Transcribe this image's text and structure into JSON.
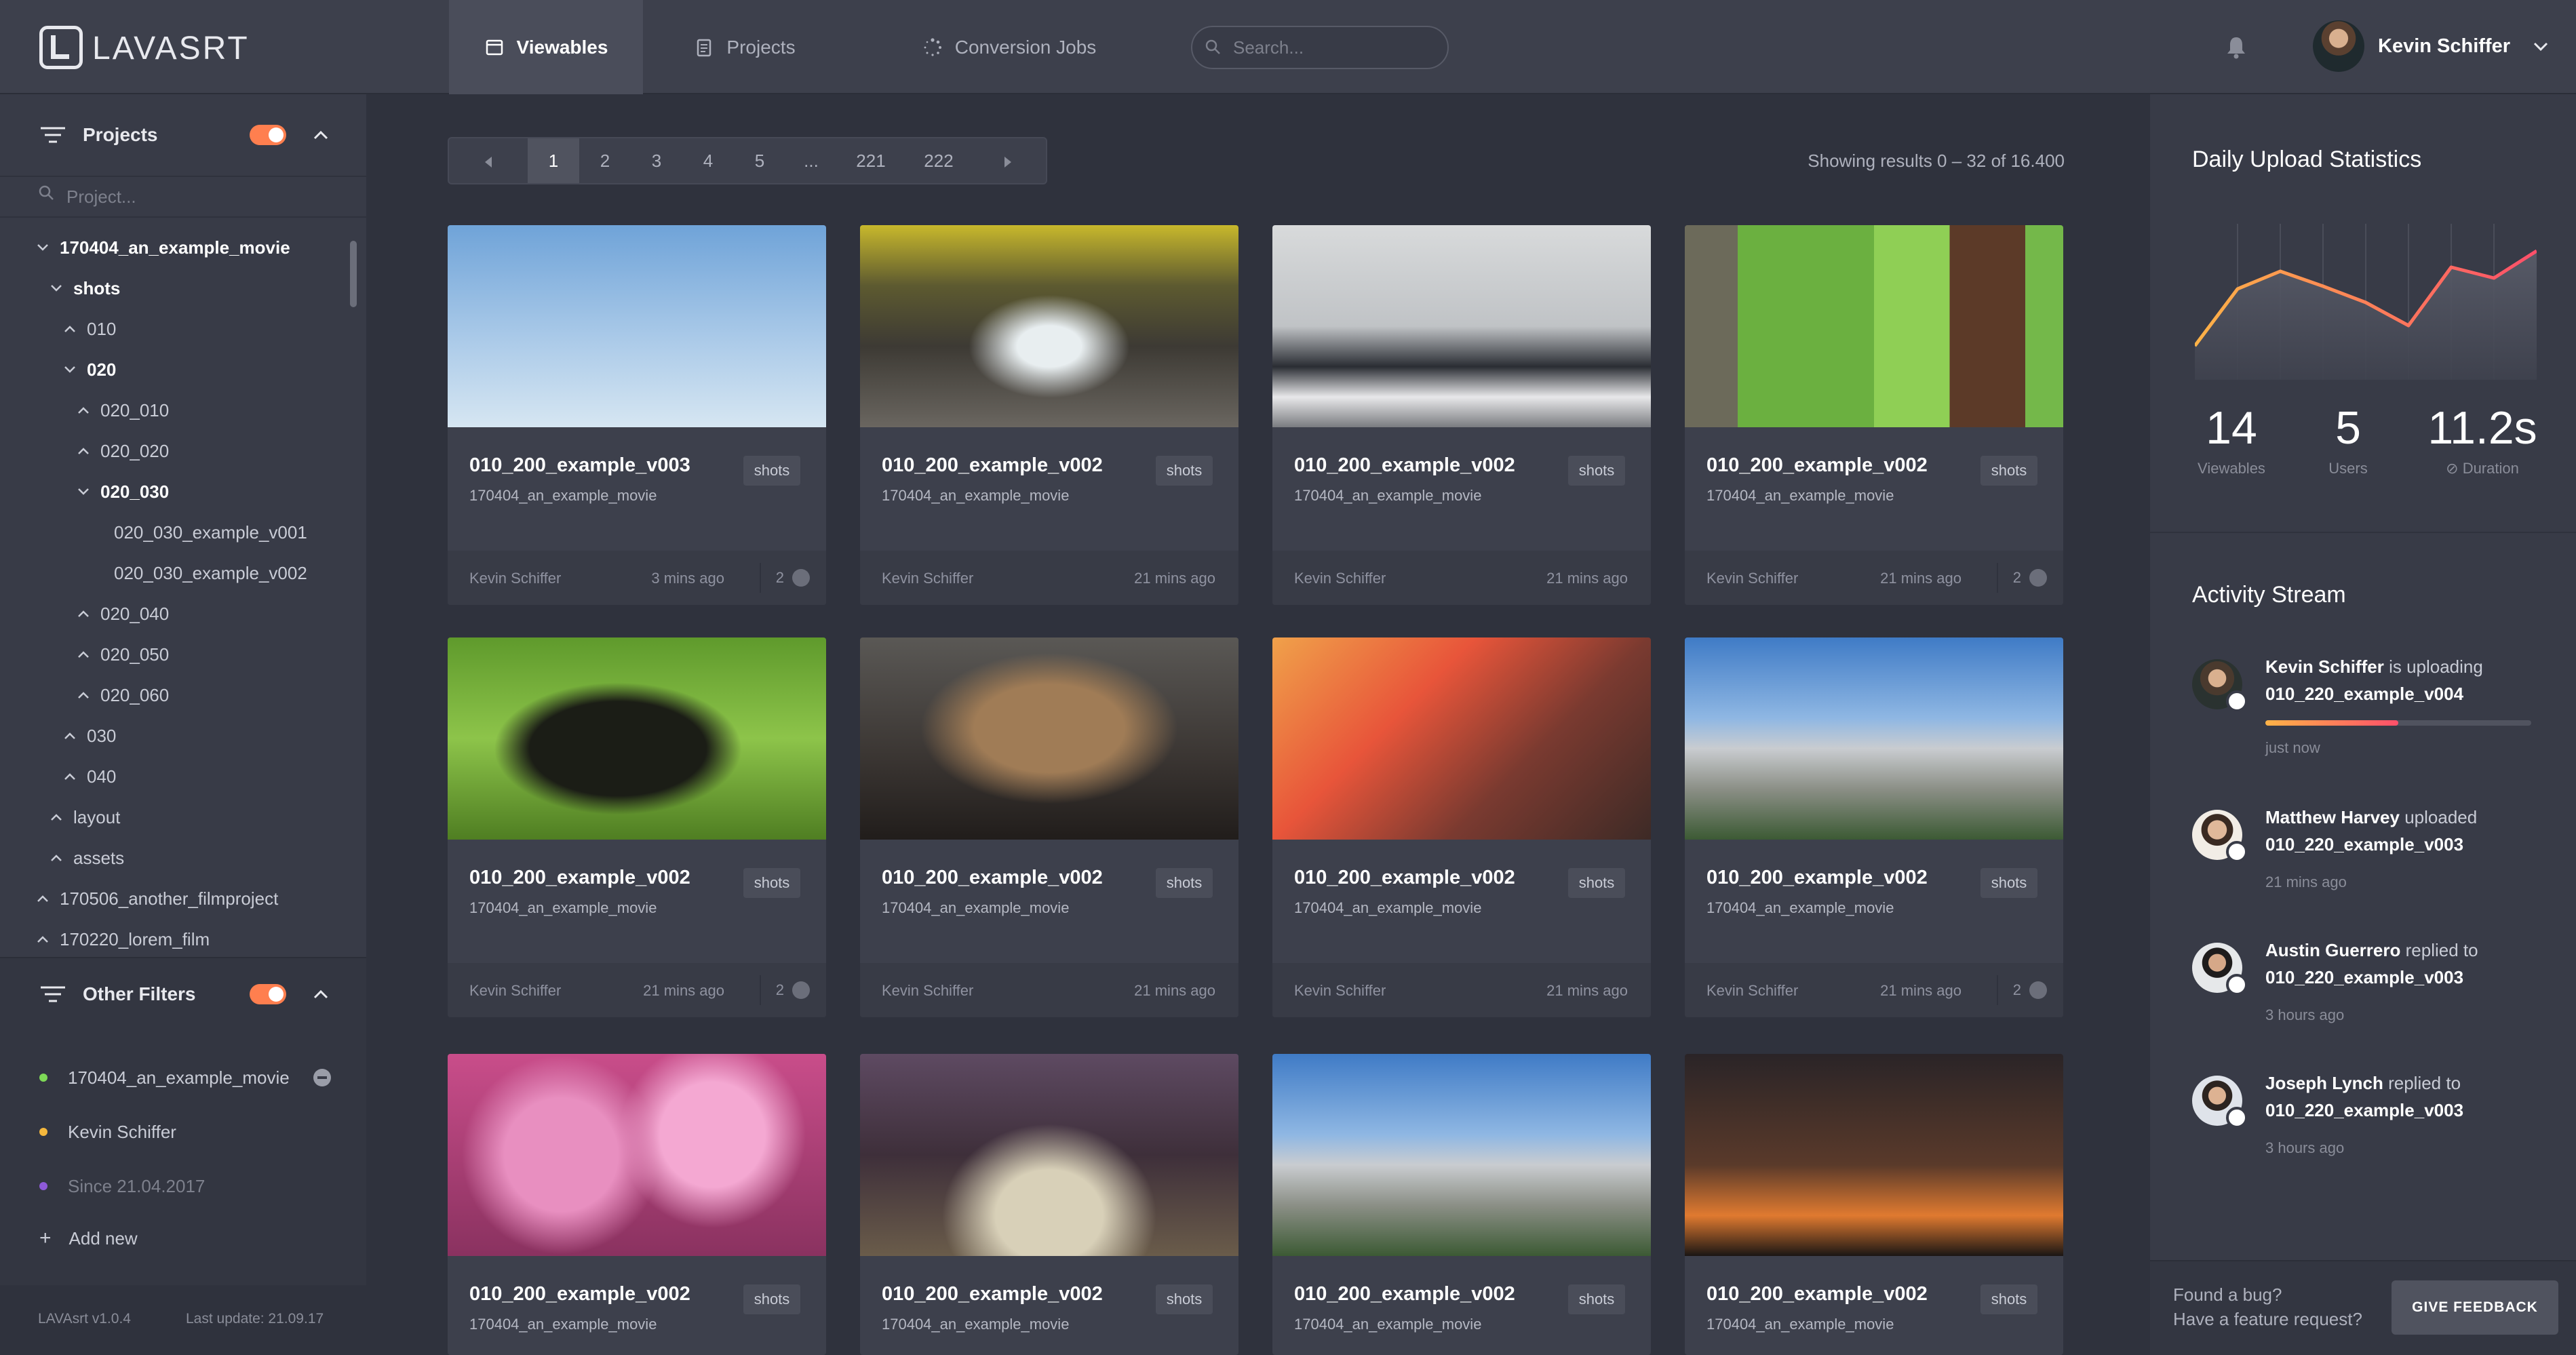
{
  "app": {
    "logo_text": "LAVASRT"
  },
  "nav": {
    "tabs": [
      "Viewables",
      "Projects",
      "Conversion Jobs"
    ],
    "active": 0
  },
  "search": {
    "placeholder": "Search..."
  },
  "user": {
    "name": "Kevin Schiffer"
  },
  "sidebar": {
    "projects_title": "Projects",
    "project_search_placeholder": "Project...",
    "tree": [
      {
        "label": "170404_an_example_movie",
        "depth": 0,
        "state": "open",
        "bold": true
      },
      {
        "label": "shots",
        "depth": 1,
        "state": "open",
        "bold": true
      },
      {
        "label": "010",
        "depth": 2,
        "state": "closed",
        "bold": false
      },
      {
        "label": "020",
        "depth": 2,
        "state": "open",
        "bold": true
      },
      {
        "label": "020_010",
        "depth": 3,
        "state": "closed",
        "bold": false
      },
      {
        "label": "020_020",
        "depth": 3,
        "state": "closed",
        "bold": false
      },
      {
        "label": "020_030",
        "depth": 3,
        "state": "open",
        "bold": true
      },
      {
        "label": "020_030_example_v001",
        "depth": 4,
        "state": "leaf",
        "bold": false
      },
      {
        "label": "020_030_example_v002",
        "depth": 4,
        "state": "leaf",
        "bold": false
      },
      {
        "label": "020_040",
        "depth": 3,
        "state": "closed",
        "bold": false
      },
      {
        "label": "020_050",
        "depth": 3,
        "state": "closed",
        "bold": false
      },
      {
        "label": "020_060",
        "depth": 3,
        "state": "closed",
        "bold": false
      },
      {
        "label": "030",
        "depth": 2,
        "state": "closed",
        "bold": false
      },
      {
        "label": "040",
        "depth": 2,
        "state": "closed",
        "bold": false
      },
      {
        "label": "layout",
        "depth": 1,
        "state": "closed",
        "bold": false
      },
      {
        "label": "assets",
        "depth": 1,
        "state": "closed",
        "bold": false
      },
      {
        "label": "170506_another_filmproject",
        "depth": 0,
        "state": "closed",
        "bold": false
      },
      {
        "label": "170220_lorem_film",
        "depth": 0,
        "state": "closed",
        "bold": false
      }
    ],
    "other_filters_title": "Other Filters",
    "filters": [
      {
        "label": "170404_an_example_movie",
        "color": "#7ed957",
        "removable": true
      },
      {
        "label": "Kevin Schiffer",
        "color": "#f5b83d",
        "removable": false
      },
      {
        "label": "Since 21.04.2017",
        "color": "#8e5ad8",
        "removable": false,
        "muted": true
      }
    ],
    "add_new": "Add new",
    "version": "LAVAsrt v1.0.4",
    "last_update": "Last update: 21.09.17"
  },
  "pagination": {
    "pages": [
      "1",
      "2",
      "3",
      "4",
      "5",
      "...",
      "221",
      "222"
    ],
    "active": "1",
    "results_text": "Showing results 0 – 32 of 16.400"
  },
  "cards": [
    {
      "title": "010_200_example_v003",
      "project": "170404_an_example_movie",
      "tag": "shots",
      "author": "Kevin Schiffer",
      "time": "3 mins ago",
      "comments": "2",
      "img": "sky"
    },
    {
      "title": "010_200_example_v002",
      "project": "170404_an_example_movie",
      "tag": "shots",
      "author": "Kevin Schiffer",
      "time": "21 mins ago",
      "comments": "",
      "img": "waterfall"
    },
    {
      "title": "010_200_example_v002",
      "project": "170404_an_example_movie",
      "tag": "shots",
      "author": "Kevin Schiffer",
      "time": "21 mins ago",
      "comments": "",
      "img": "street"
    },
    {
      "title": "010_200_example_v002",
      "project": "170404_an_example_movie",
      "tag": "shots",
      "author": "Kevin Schiffer",
      "time": "21 mins ago",
      "comments": "2",
      "img": "forest"
    },
    {
      "title": "010_200_example_v002",
      "project": "170404_an_example_movie",
      "tag": "shots",
      "author": "Kevin Schiffer",
      "time": "21 mins ago",
      "comments": "2",
      "img": "dog"
    },
    {
      "title": "010_200_example_v002",
      "project": "170404_an_example_movie",
      "tag": "shots",
      "author": "Kevin Schiffer",
      "time": "21 mins ago",
      "comments": "",
      "img": "cat"
    },
    {
      "title": "010_200_example_v002",
      "project": "170404_an_example_movie",
      "tag": "shots",
      "author": "Kevin Schiffer",
      "time": "21 mins ago",
      "comments": "",
      "img": "city"
    },
    {
      "title": "010_200_example_v002",
      "project": "170404_an_example_movie",
      "tag": "shots",
      "author": "Kevin Schiffer",
      "time": "21 mins ago",
      "comments": "2",
      "img": "mountain"
    },
    {
      "title": "010_200_example_v002",
      "project": "170404_an_example_movie",
      "tag": "shots",
      "author": "",
      "time": "",
      "comments": "",
      "img": "blossom"
    },
    {
      "title": "010_200_example_v002",
      "project": "170404_an_example_movie",
      "tag": "shots",
      "author": "",
      "time": "",
      "comments": "",
      "img": "arch"
    },
    {
      "title": "010_200_example_v002",
      "project": "170404_an_example_movie",
      "tag": "shots",
      "author": "",
      "time": "",
      "comments": "",
      "img": "mountain"
    },
    {
      "title": "010_200_example_v002",
      "project": "170404_an_example_movie",
      "tag": "shots",
      "author": "",
      "time": "",
      "comments": "",
      "img": "sunset"
    }
  ],
  "stats": {
    "title": "Daily Upload Statistics",
    "values": [
      {
        "value": "14",
        "label": "Viewables"
      },
      {
        "value": "5",
        "label": "Users"
      },
      {
        "value": "11.2s",
        "label": "Duration"
      }
    ]
  },
  "chart_data": {
    "type": "area",
    "title": "Daily Upload Statistics",
    "x": [
      0,
      1,
      2,
      3,
      4,
      5,
      6,
      7
    ],
    "values": [
      20,
      62,
      75,
      64,
      52,
      35,
      78,
      70,
      90
    ],
    "ylim": [
      0,
      100
    ],
    "grid": true,
    "colors": [
      "#ffb347",
      "#ff4f6a"
    ]
  },
  "activity": {
    "title": "Activity Stream",
    "items": [
      {
        "user": "Kevin Schiffer",
        "action": "is uploading",
        "target": "010_220_example_v004",
        "time": "just now",
        "progress": 0.5
      },
      {
        "user": "Matthew Harvey",
        "action": "uploaded",
        "target": "010_220_example_v003",
        "time": "21 mins ago"
      },
      {
        "user": "Austin Guerrero",
        "action": "replied to",
        "target": "010_220_example_v003",
        "time": "3 hours ago"
      },
      {
        "user": "Joseph Lynch",
        "action": "replied to",
        "target": "010_220_example_v003",
        "time": "3 hours ago"
      }
    ]
  },
  "feedback": {
    "line1": "Found a bug?",
    "line2": "Have a feature request?",
    "button": "GIVE FEEDBACK"
  }
}
